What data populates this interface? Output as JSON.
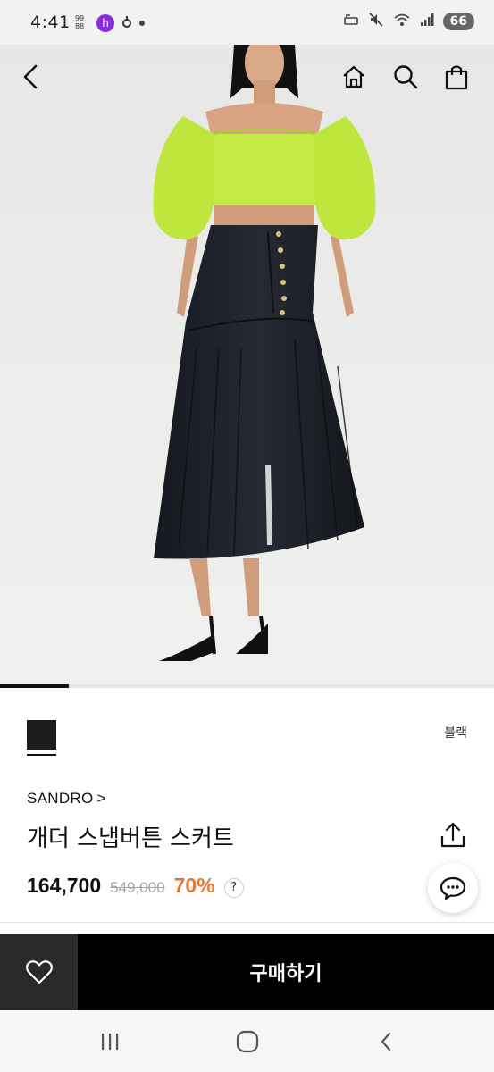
{
  "status_bar": {
    "time": "4:41",
    "battery": "66",
    "icons": [
      "rotation-icon",
      "mute-icon",
      "wifi-icon",
      "signal-icon"
    ]
  },
  "header": {
    "back_icon": "chevron-left-icon",
    "home_icon": "home-icon",
    "search_icon": "search-icon",
    "cart_icon": "shopping-bag-icon"
  },
  "gallery": {
    "progress": 0.14
  },
  "product": {
    "color_name": "블랙",
    "swatch_color": "#1c1c1c",
    "brand": "SANDRO",
    "brand_chevron": ">",
    "title": "개더 스냅버튼 스커트",
    "price": "164,700",
    "original_price": "549,000",
    "discount": "70%",
    "discount_color": "#e8772e",
    "help_label": "?"
  },
  "actions": {
    "buy_label": "구매하기",
    "wish_icon": "heart-icon",
    "chat_icon": "chat-icon",
    "share_icon": "share-icon"
  },
  "system_nav": {
    "recents_icon": "recents-icon",
    "home_icon": "home-circle-icon",
    "back_icon": "back-chevron-icon"
  }
}
